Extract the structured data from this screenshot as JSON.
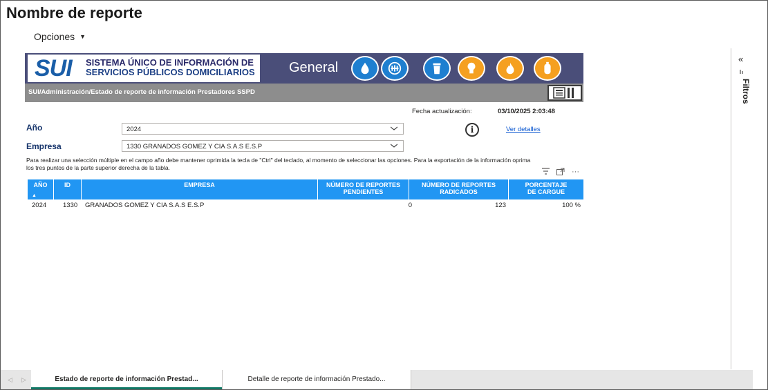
{
  "report": {
    "title": "Nombre de reporte",
    "options_label": "Opciones"
  },
  "banner": {
    "sui_mark": "SUI",
    "system_name_line1": "SISTEMA ÚNICO DE INFORMACIÓN DE",
    "system_name_line2": "SERVICIOS PÚBLICOS DOMICILIARIOS",
    "section_label": "General",
    "service_icons": [
      {
        "name": "water-drop-icon",
        "color": "#1e7fd0"
      },
      {
        "name": "sewer-grate-icon",
        "color": "#1e7fd0"
      },
      {
        "name": "trash-bin-icon",
        "color": "#1e7fd0"
      },
      {
        "name": "light-bulb-icon",
        "color": "#f5a020"
      },
      {
        "name": "flame-icon",
        "color": "#f5a020"
      },
      {
        "name": "gas-cylinder-icon",
        "color": "#f5a020"
      }
    ],
    "breadcrumb": "SUI/Administración/Estado de reporte de información Prestadores SSPD"
  },
  "update": {
    "label": "Fecha actualización:",
    "value": "03/10/2025 2:03:48"
  },
  "filters": {
    "year_label": "Año",
    "year_value": "2024",
    "company_label": "Empresa",
    "company_value": "1330 GRANADOS GOMEZ Y CIA S.A.S E.S.P",
    "details_link": "Ver detalles"
  },
  "help_text": "Para realizar una selección múltiple en el campo año debe mantener oprimida la tecla de \"Ctrl\" del teclado, al momento de seleccionar las opciones. Para la exportación de la información oprima los tres puntos de la parte superior derecha de la tabla.",
  "table": {
    "columns": [
      "AÑO",
      "ID",
      "EMPRESA",
      "NÚMERO DE REPORTES PENDIENTES",
      "NÚMERO DE REPORTES RADICADOS",
      "PORCENTAJE DE CARGUE"
    ],
    "rows": [
      [
        "2024",
        "1330",
        "GRANADOS GOMEZ Y CIA S.A.S E.S.P",
        "0",
        "123",
        "100 %"
      ]
    ],
    "header_color": "#2196f3"
  },
  "filter_pane": {
    "label": "Filtros",
    "collapse_glyph": "«"
  },
  "pages": {
    "tabs": [
      "Estado de reporte de información Prestad...",
      "Detalle de reporte de información Prestado..."
    ],
    "active_index": 0
  }
}
